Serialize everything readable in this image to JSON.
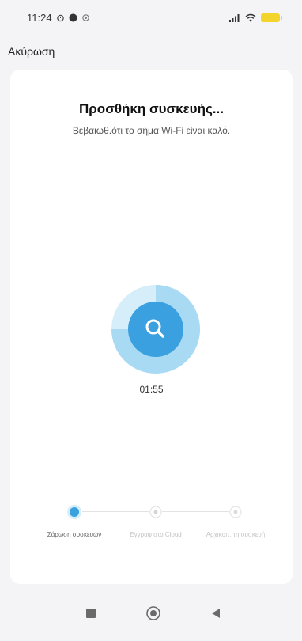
{
  "status_bar": {
    "time": "11:24"
  },
  "header": {
    "cancel_label": "Ακύρωση"
  },
  "main": {
    "title": "Προσθήκη συσκευής...",
    "subtitle": "Βεβαιωθ.ότι το σήμα Wi-Fi είναι καλό.",
    "timer": "01:55",
    "scan_progress": 0.75
  },
  "steps": [
    {
      "label": "Σάρωση συσκευών",
      "active": true
    },
    {
      "label": "Εγγραφ στο Cloud",
      "active": false
    },
    {
      "label": "Αρχικοπ. τη συσκευή",
      "active": false
    }
  ],
  "colors": {
    "accent": "#3aa0df",
    "accent_light": "#a9daf3",
    "accent_pale": "#d6eefa",
    "battery": "#f2d42a"
  },
  "nav": {
    "icons": [
      "square-icon",
      "home-circle-icon",
      "back-triangle-icon"
    ]
  }
}
